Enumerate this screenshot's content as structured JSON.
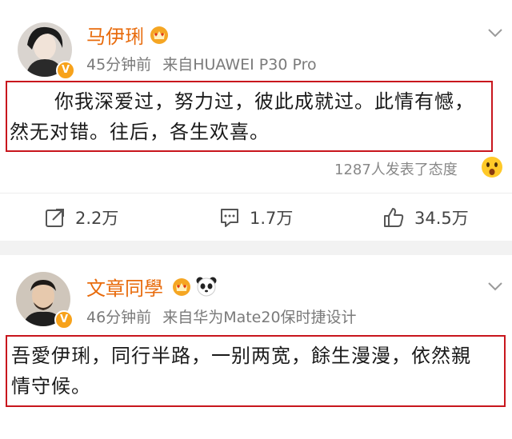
{
  "posts": [
    {
      "username": "马伊琍",
      "time": "45分钟前",
      "source": "来自HUAWEI P30 Pro",
      "content_line1": "你我深爱过，努力过，彼此成就过。此情有憾，",
      "content_line2": "然无对错。往后，各生欢喜。",
      "attitude": "1287人发表了态度",
      "share_count": "2.2万",
      "comment_count": "1.7万",
      "like_count": "34.5万"
    },
    {
      "username": "文章同學",
      "time": "46分钟前",
      "source": "来自华为Mate20保时捷设计",
      "content_line1": "吾愛伊琍，同行半路，一别两宽，餘生漫漫，依然親",
      "content_line2": "情守候。"
    }
  ],
  "icons": {
    "verified": "verified-badge-icon",
    "crown": "crown-membership-icon",
    "panda": "panda-icon",
    "chevron": "chevron-down-icon",
    "share": "share-icon",
    "comment": "comment-icon",
    "like": "thumbs-up-icon",
    "surprised": "surprised-face-icon"
  },
  "colors": {
    "username": "#e86b0c",
    "highlight_border": "#c8161d",
    "verified": "#f7a21b"
  }
}
